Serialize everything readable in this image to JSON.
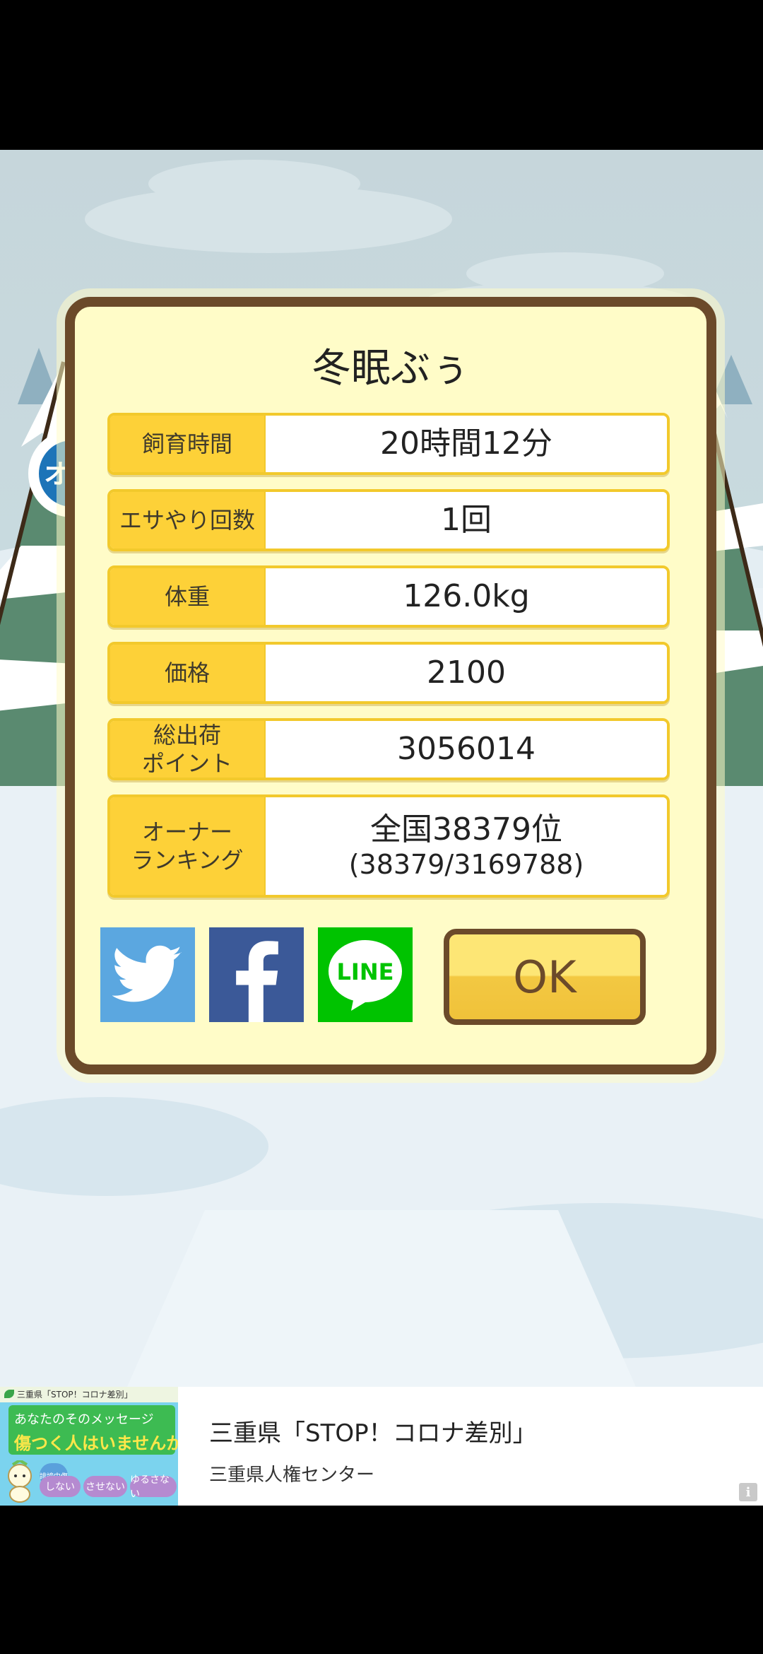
{
  "dialog": {
    "title": "冬眠ぶぅ",
    "gender_badge": "オス",
    "stats": [
      {
        "label": "飼育時間",
        "value": "20時間12分"
      },
      {
        "label": "エサやり回数",
        "value": "1回"
      },
      {
        "label": "体重",
        "value": "126.0kg"
      },
      {
        "label": "価格",
        "value": "2100"
      },
      {
        "label_line1": "総出荷",
        "label_line2": "ポイント",
        "value": "3056014"
      },
      {
        "label_line1": "オーナー",
        "label_line2": "ランキング",
        "value": "全国38379位",
        "value_sub": "(38379/3169788)"
      }
    ],
    "share_buttons": [
      {
        "icon": "twitter-icon",
        "color": "#5ba7e0"
      },
      {
        "icon": "facebook-icon",
        "color": "#3b5998"
      },
      {
        "icon": "line-icon",
        "text": "LINE",
        "color": "#00c300"
      }
    ],
    "ok_label": "OK"
  },
  "ad": {
    "thumb_header": "三重県「STOP！コロナ差別」",
    "thumb_line1": "あなたのそのメッセージ",
    "thumb_line2": "傷つく人はいませんか?",
    "thumb_pill0": "誹謗中傷",
    "thumb_pill1": "しない",
    "thumb_pill2": "させない",
    "thumb_pill3": "ゆるさない",
    "title": "三重県「STOP！コロナ差別」",
    "subtitle": "三重県人権センター",
    "info_icon": "i"
  }
}
